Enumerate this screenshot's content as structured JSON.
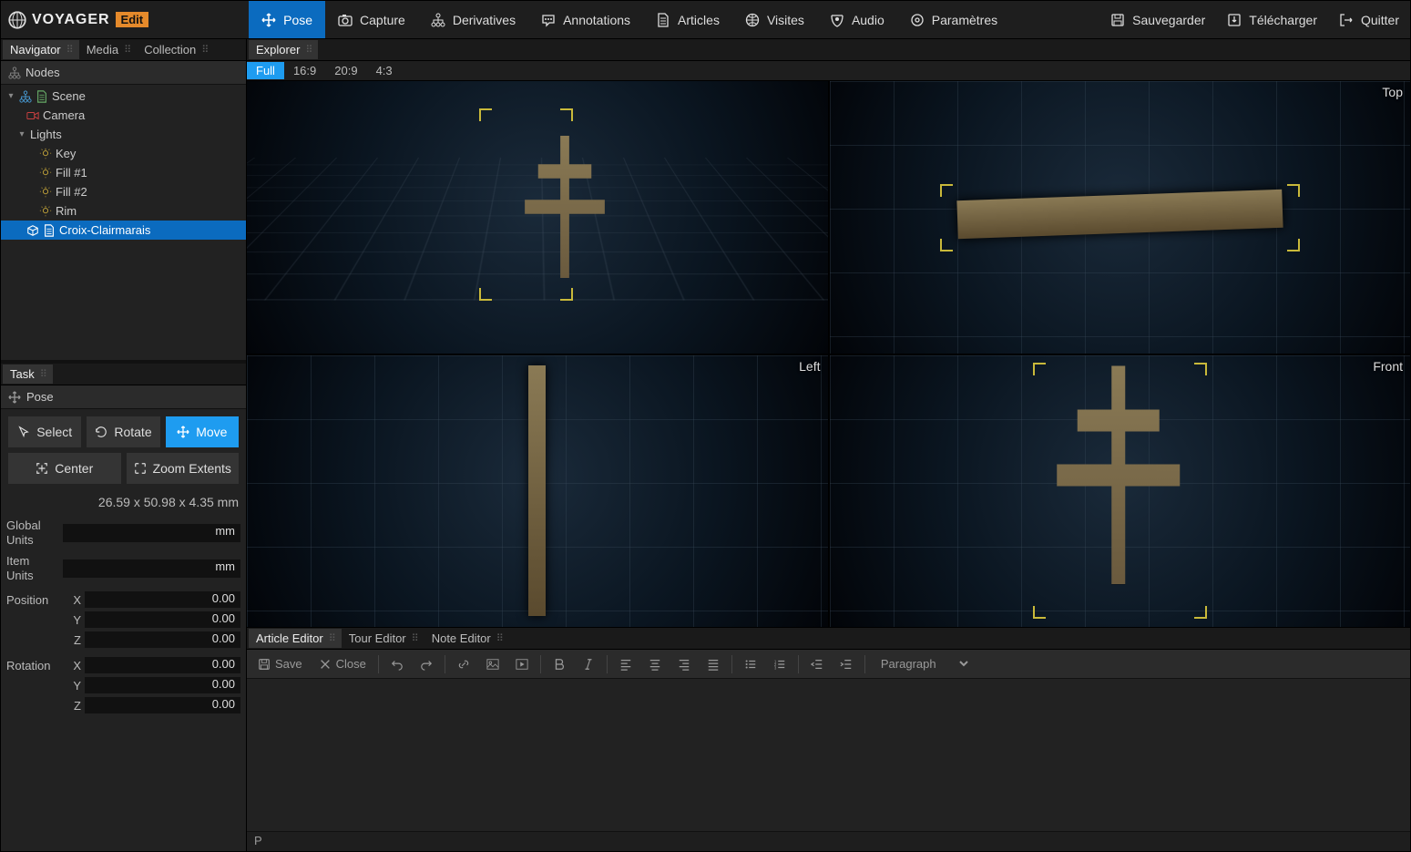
{
  "app": {
    "name": "VOYAGER",
    "badge": "Edit"
  },
  "topmenu": {
    "left": [
      {
        "icon": "move",
        "label": "Pose",
        "active": true
      },
      {
        "icon": "camera",
        "label": "Capture"
      },
      {
        "icon": "hierarchy",
        "label": "Derivatives"
      },
      {
        "icon": "comment",
        "label": "Annotations"
      },
      {
        "icon": "doc",
        "label": "Articles"
      },
      {
        "icon": "globe",
        "label": "Visites"
      },
      {
        "icon": "audio",
        "label": "Audio"
      },
      {
        "icon": "gear",
        "label": "Paramètres"
      }
    ],
    "right": [
      {
        "icon": "save",
        "label": "Sauvegarder"
      },
      {
        "icon": "download",
        "label": "Télécharger"
      },
      {
        "icon": "exit",
        "label": "Quitter"
      }
    ]
  },
  "leftTabs": [
    {
      "label": "Navigator",
      "active": true
    },
    {
      "label": "Media"
    },
    {
      "label": "Collection"
    }
  ],
  "navigator": {
    "header": "Nodes",
    "tree": [
      {
        "depth": 0,
        "caret": "down",
        "icon": "hierarchy",
        "icon2": "doc",
        "label": "Scene"
      },
      {
        "depth": 1,
        "icon": "camera-red",
        "label": "Camera"
      },
      {
        "depth": 1,
        "caret": "down",
        "label": "Lights"
      },
      {
        "depth": 2,
        "icon": "light",
        "label": "Key"
      },
      {
        "depth": 2,
        "icon": "light",
        "label": "Fill #1"
      },
      {
        "depth": 2,
        "icon": "light",
        "label": "Fill #2"
      },
      {
        "depth": 2,
        "icon": "light",
        "label": "Rim"
      },
      {
        "depth": 1,
        "icon": "cube",
        "icon2": "doc",
        "label": "Croix-Clairmarais",
        "selected": true
      }
    ]
  },
  "taskTab": "Task",
  "taskHeader": "Pose",
  "poseTools": {
    "row1": [
      {
        "icon": "cursor",
        "label": "Select"
      },
      {
        "icon": "rotate",
        "label": "Rotate"
      },
      {
        "icon": "move",
        "label": "Move",
        "active": true
      }
    ],
    "row2": [
      {
        "icon": "center",
        "label": "Center"
      },
      {
        "icon": "extents",
        "label": "Zoom Extents"
      }
    ],
    "dimensions": "26.59 x 50.98 x 4.35 mm",
    "globalUnits": {
      "label": "Global Units",
      "value": "mm"
    },
    "itemUnits": {
      "label": "Item Units",
      "value": "mm"
    },
    "position": {
      "label": "Position",
      "x": "0.00",
      "y": "0.00",
      "z": "0.00"
    },
    "rotation": {
      "label": "Rotation",
      "x": "0.00",
      "y": "0.00",
      "z": "0.00"
    }
  },
  "explorerTab": "Explorer",
  "aspectTabs": [
    {
      "label": "Full",
      "active": true
    },
    {
      "label": "16:9"
    },
    {
      "label": "20:9"
    },
    {
      "label": "4:3"
    }
  ],
  "viewports": {
    "top": "Top",
    "left": "Left",
    "front": "Front"
  },
  "bottomTabs": [
    {
      "label": "Article Editor",
      "active": true
    },
    {
      "label": "Tour Editor"
    },
    {
      "label": "Note Editor"
    }
  ],
  "editor": {
    "save": "Save",
    "close": "Close",
    "paragraph": "Paragraph",
    "status": "P"
  }
}
